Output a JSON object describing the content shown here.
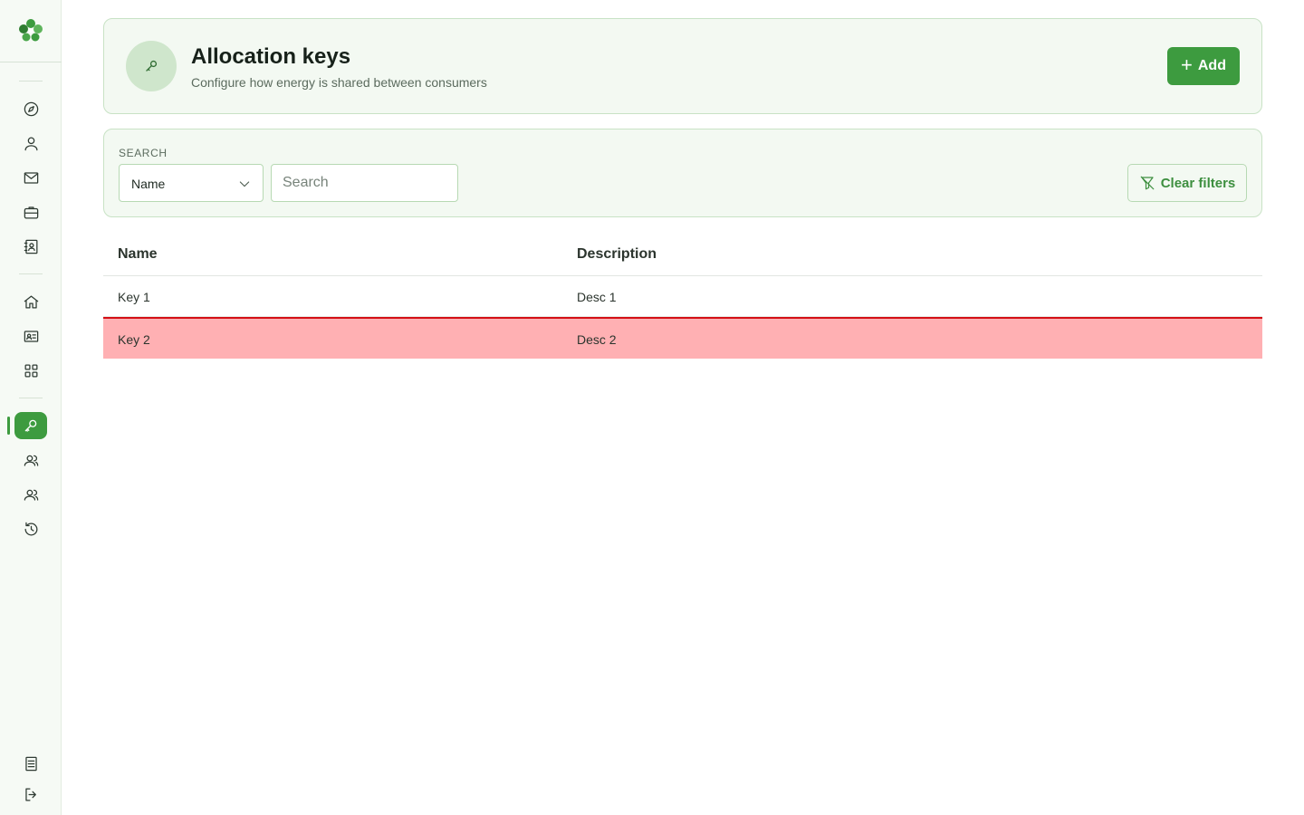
{
  "sidebar": {
    "logo": "clover-logo",
    "items": [
      {
        "icon": "compass-icon"
      },
      {
        "icon": "user-icon"
      },
      {
        "icon": "mail-icon"
      },
      {
        "icon": "briefcase-icon"
      },
      {
        "icon": "contact-book-icon"
      },
      {
        "icon": "home-icon"
      },
      {
        "icon": "id-card-icon"
      },
      {
        "icon": "grid-icon"
      },
      {
        "icon": "key-icon",
        "active": true
      },
      {
        "icon": "users-icon"
      },
      {
        "icon": "users-icon"
      },
      {
        "icon": "history-icon"
      }
    ],
    "bottom": [
      {
        "icon": "document-icon"
      },
      {
        "icon": "logout-icon"
      }
    ]
  },
  "header": {
    "icon": "key-icon",
    "title": "Allocation keys",
    "subtitle": "Configure how energy is shared between consumers",
    "add_label": "Add"
  },
  "search": {
    "label": "SEARCH",
    "field_selected": "Name",
    "placeholder": "Search",
    "clear_label": "Clear filters"
  },
  "table": {
    "columns": [
      "Name",
      "Description"
    ],
    "rows": [
      {
        "name": "Key 1",
        "description": "Desc 1",
        "selected": false
      },
      {
        "name": "Key 2",
        "description": "Desc 2",
        "selected": true
      }
    ]
  },
  "colors": {
    "accent": "#3d9b3f",
    "card_bg": "#f3f9f2",
    "selected_row_bg": "#ffb0b3",
    "selected_row_border": "#d40f16"
  }
}
